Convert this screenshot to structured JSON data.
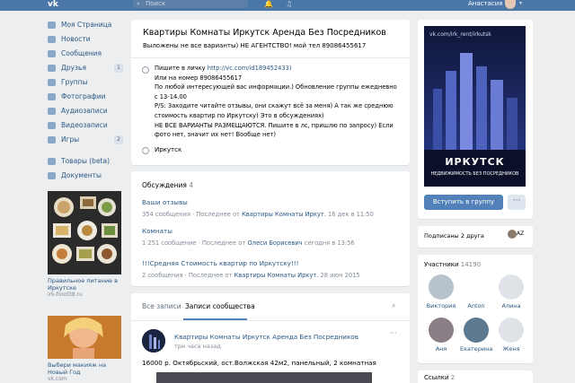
{
  "header": {
    "logo": "vk",
    "search_placeholder": "Поиск",
    "user_name": "Анастасия"
  },
  "nav": {
    "items": [
      {
        "label": "Моя Страница",
        "icon": "home-icon"
      },
      {
        "label": "Новости",
        "icon": "news-icon"
      },
      {
        "label": "Сообщения",
        "icon": "messages-icon"
      },
      {
        "label": "Друзья",
        "icon": "friends-icon",
        "count": "1"
      },
      {
        "label": "Группы",
        "icon": "groups-icon"
      },
      {
        "label": "Фотографии",
        "icon": "photos-icon"
      },
      {
        "label": "Аудиозаписи",
        "icon": "audio-icon"
      },
      {
        "label": "Видеозаписи",
        "icon": "video-icon"
      },
      {
        "label": "Игры",
        "icon": "games-icon",
        "count": "2"
      }
    ],
    "extra": [
      {
        "label": "Товары (beta)",
        "icon": "market-icon"
      },
      {
        "label": "Документы",
        "icon": "documents-icon"
      }
    ]
  },
  "ads": [
    {
      "title": "Правильное питание в Иркутске",
      "source": "irk-food38.ru"
    },
    {
      "title": "Выбери макияж на Новый Год",
      "source": "vk.com"
    }
  ],
  "group": {
    "title": "Квартиры Комнаты Иркутск Аренда Без Посредников",
    "status": "Выложены не все варианты) НЕ АГЕНТСТВО! мой тел 89086455617",
    "info_lines": [
      {
        "prefix": "Пишите в личку ",
        "link": "http://vc.com/id189452433)"
      },
      {
        "text": "Или на номер 89086455617"
      },
      {
        "text": "По любой интересующей вас информации.) Обновление группы ежедневно"
      },
      {
        "text": "с 13-14.00"
      },
      {
        "text": "P/S: Заходите читайте отзывы, они скажут всё за меня) А так же среднюю"
      },
      {
        "text": "стоимость квартир по Иркутску) Это в обсуждениях)"
      },
      {
        "text": "НЕ ВСЕ ВАРИАНТЫ РАЗМЕЩАЮТСЯ. Пишите в лс, пришлю по запросу) Если"
      },
      {
        "text": "фото нет, значит их нет! Вообще нет)"
      }
    ],
    "city": "Иркутск"
  },
  "discussions": {
    "title": "Обсуждения",
    "count": "4",
    "topics": [
      {
        "name": "Ваши отзывы",
        "meta": "354 сообщения  ·  Последнее от ",
        "author": "Квартиры Комнаты Иркут.",
        "when": " 16 дек в 11:50"
      },
      {
        "name": "Комнаты",
        "meta": "1 251 сообщение  ·  Последнее от ",
        "author": "Олеси Борисевич",
        "when": " сегодня в 13:56"
      },
      {
        "name": "!!!Средняя Стоимость квартир по Иркутску!!!",
        "meta": "2 сообщения  ·  Последнее от ",
        "author": "Квартиры Комнаты Иркут.",
        "when": " 28 июн 2015"
      }
    ]
  },
  "wall": {
    "tabs": [
      "Все записи",
      "Записи сообщества"
    ],
    "post": {
      "author": "Квартиры Комнаты Иркутск Аренда Без Посредников",
      "time": "три часа назад",
      "text": "16000 р. Октябрьский, ост.Волжская 42м2, панельный, 2 комнатная"
    }
  },
  "cover": {
    "url": "vk.com/irk_rent/irkutsk",
    "city": "ИРКУТСК",
    "subtitle": "НЕДВИЖИМОСТЬ БЕЗ ПОСРЕДНИКОВ"
  },
  "actions": {
    "join": "Вступить в группу",
    "more": "···"
  },
  "friends_line": {
    "text": "Подписаны 2 друга"
  },
  "members": {
    "title": "Участники",
    "count": "14190",
    "list": [
      {
        "name": "Виктория",
        "color": "#b8c2cc"
      },
      {
        "name": "Anton",
        "color": "#ffffff"
      },
      {
        "name": "Алина",
        "color": "#dfe3e8"
      },
      {
        "name": "Аня",
        "color": "#8a7f86"
      },
      {
        "name": "Екатерина",
        "color": "#5e7a91"
      },
      {
        "name": "Женя",
        "color": "#dfe3e8"
      }
    ]
  },
  "links": {
    "title": "Ссылки",
    "count": "2"
  }
}
